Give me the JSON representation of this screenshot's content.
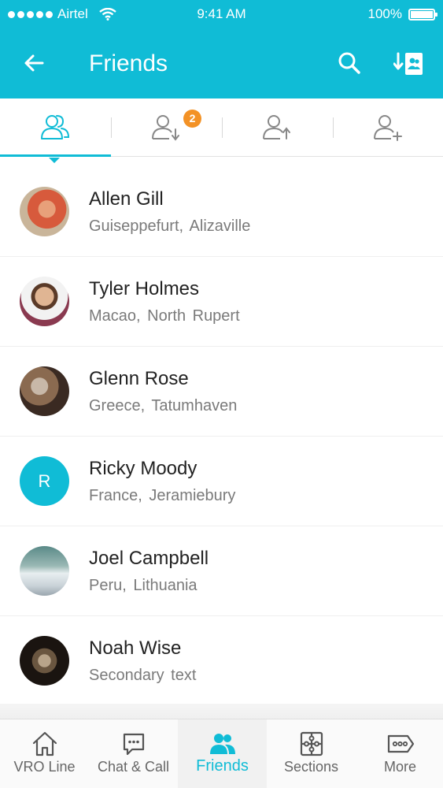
{
  "status_bar": {
    "carrier": "Airtel",
    "time": "9:41 AM",
    "battery": "100%"
  },
  "header": {
    "title": "Friends",
    "back_icon": "arrow-left-icon",
    "search_icon": "search-icon",
    "contacts_icon": "contacts-icon"
  },
  "tabs": [
    {
      "icon": "friends-icon",
      "active": true
    },
    {
      "icon": "incoming-request-icon",
      "badge": "2"
    },
    {
      "icon": "outgoing-request-icon"
    },
    {
      "icon": "add-friend-icon"
    }
  ],
  "friends": [
    {
      "name": "Allen Gill",
      "city": "Guiseppefurt,",
      "place": "Alizaville"
    },
    {
      "name": "Tyler Holmes",
      "city": "Macao,",
      "place": "North Rupert"
    },
    {
      "name": "Glenn Rose",
      "city": "Greece,",
      "place": "Tatumhaven"
    },
    {
      "name": "Ricky Moody",
      "city": "France,",
      "place": "Jeramiebury",
      "initial": "R"
    },
    {
      "name": "Joel Campbell",
      "city": "Peru,",
      "place": "Lithuania"
    },
    {
      "name": "Noah Wise",
      "city": "Secondary text",
      "place": ""
    }
  ],
  "bottom_nav": [
    {
      "label": "VRO Line",
      "icon": "home-icon"
    },
    {
      "label": "Chat & Call",
      "icon": "chat-icon"
    },
    {
      "label": "Friends",
      "icon": "friends-icon",
      "active": true
    },
    {
      "label": "Sections",
      "icon": "sections-icon"
    },
    {
      "label": "More",
      "icon": "more-icon"
    }
  ],
  "colors": {
    "primary": "#10bcd6",
    "badge": "#f39226"
  }
}
